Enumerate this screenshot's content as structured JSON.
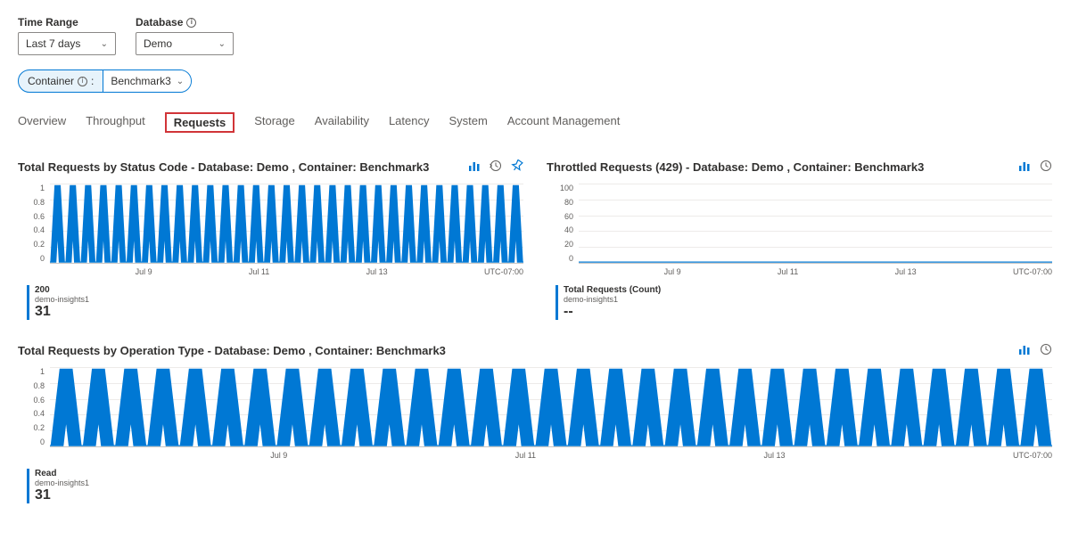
{
  "filters": {
    "time_range_label": "Time Range",
    "time_range_value": "Last 7 days",
    "database_label": "Database",
    "database_value": "Demo",
    "container_label": "Container",
    "container_value": "Benchmark3"
  },
  "tabs": [
    "Overview",
    "Throughput",
    "Requests",
    "Storage",
    "Availability",
    "Latency",
    "System",
    "Account Management"
  ],
  "active_tab": "Requests",
  "chart1": {
    "title": "Total Requests by Status Code - Database: Demo , Container: Benchmark3",
    "y_ticks": [
      "1",
      "0.8",
      "0.6",
      "0.4",
      "0.2",
      "0"
    ],
    "x_ticks": [
      "Jul 9",
      "Jul 11",
      "Jul 13",
      "UTC-07:00"
    ],
    "legend_name": "200",
    "legend_sub": "demo-insights1",
    "legend_val": "31"
  },
  "chart2": {
    "title": "Throttled Requests (429) - Database: Demo , Container: Benchmark3",
    "y_ticks": [
      "100",
      "80",
      "60",
      "40",
      "20",
      "0"
    ],
    "x_ticks": [
      "Jul 9",
      "Jul 11",
      "Jul 13",
      "UTC-07:00"
    ],
    "legend_name": "Total Requests (Count)",
    "legend_sub": "demo-insights1",
    "legend_val": "--"
  },
  "chart3": {
    "title": "Total Requests by Operation Type - Database: Demo , Container: Benchmark3",
    "y_ticks": [
      "1",
      "0.8",
      "0.6",
      "0.4",
      "0.2",
      "0"
    ],
    "x_ticks": [
      "Jul 9",
      "Jul 11",
      "Jul 13",
      "UTC-07:00"
    ],
    "legend_name": "Read",
    "legend_sub": "demo-insights1",
    "legend_val": "31"
  },
  "chart_data": [
    {
      "type": "line",
      "title": "Total Requests by Status Code",
      "series": [
        {
          "name": "200",
          "values_pattern": "31 spikes between 0 and 1 over Jul 8–Jul 14"
        }
      ],
      "ylim": [
        0,
        1
      ],
      "ylabel": "",
      "xlabel": "",
      "x_range": [
        "Jul 8",
        "Jul 14"
      ]
    },
    {
      "type": "line",
      "title": "Throttled Requests (429)",
      "series": [
        {
          "name": "Total Requests (Count)",
          "values": "flat at 0"
        }
      ],
      "ylim": [
        0,
        100
      ],
      "x_range": [
        "Jul 8",
        "Jul 14"
      ]
    },
    {
      "type": "line",
      "title": "Total Requests by Operation Type",
      "series": [
        {
          "name": "Read",
          "values_pattern": "31 spikes between 0 and 1 over Jul 8–Jul 14"
        }
      ],
      "ylim": [
        0,
        1
      ],
      "x_range": [
        "Jul 8",
        "Jul 14"
      ]
    }
  ]
}
